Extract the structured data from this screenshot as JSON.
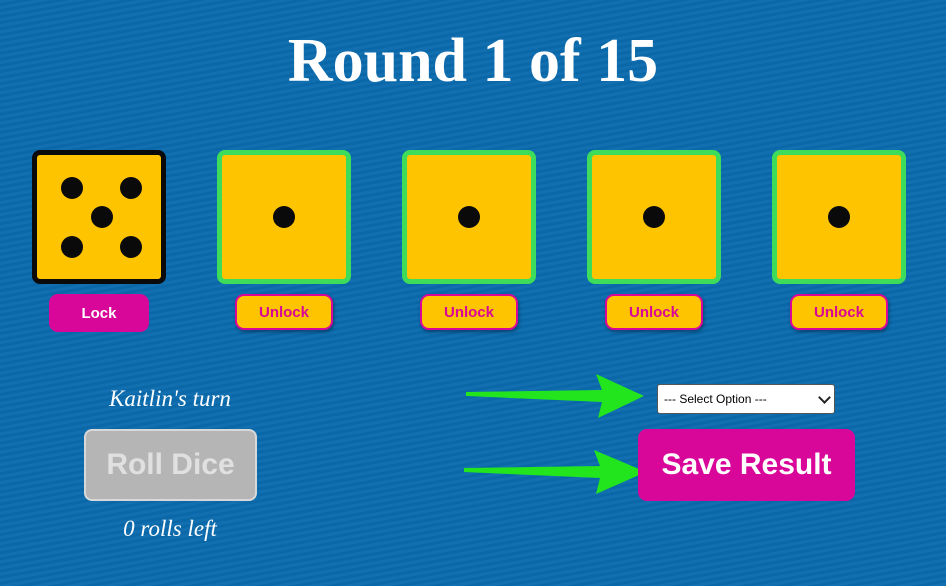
{
  "title": "Round 1 of 15",
  "dice": [
    {
      "value": 5,
      "state": "locked",
      "button_label": "Lock"
    },
    {
      "value": 1,
      "state": "unlocked",
      "button_label": "Unlock"
    },
    {
      "value": 1,
      "state": "unlocked",
      "button_label": "Unlock"
    },
    {
      "value": 1,
      "state": "unlocked",
      "button_label": "Unlock"
    },
    {
      "value": 1,
      "state": "unlocked",
      "button_label": "Unlock"
    }
  ],
  "turn_text": "Kaitlin's turn",
  "roll_button_label": "Roll Dice",
  "rolls_left_text": "0 rolls left",
  "select": {
    "selected": "--- Select Option ---"
  },
  "save_button_label": "Save Result",
  "colors": {
    "background": "#0a6aad",
    "die_face": "#ffc400",
    "accent": "#d9069a",
    "unlocked_border": "#3ddc5a",
    "arrow": "#22e51e"
  }
}
